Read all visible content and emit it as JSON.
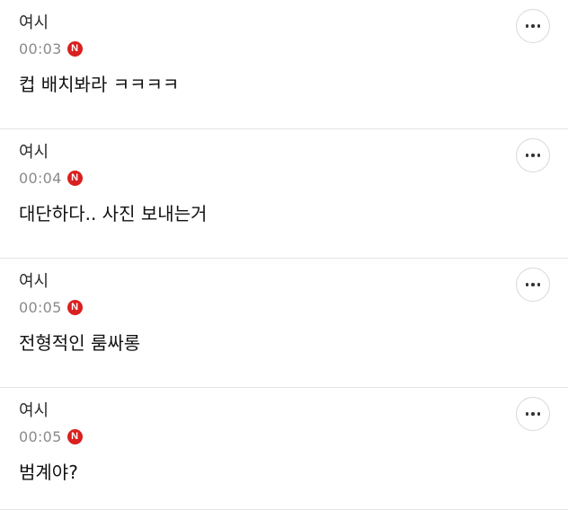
{
  "comments": [
    {
      "author": "여시",
      "time": "00:03",
      "badge": "N",
      "text": "컵 배치봐라 ㅋㅋㅋㅋ"
    },
    {
      "author": "여시",
      "time": "00:04",
      "badge": "N",
      "text": "대단하다.. 사진 보내는거"
    },
    {
      "author": "여시",
      "time": "00:05",
      "badge": "N",
      "text": "전형적인 룸싸롱"
    },
    {
      "author": "여시",
      "time": "00:05",
      "badge": "N",
      "text": "범계야?"
    }
  ],
  "icons": {
    "more": "more-options-icon",
    "new": "new-badge-icon"
  },
  "colors": {
    "badge": "#d9201f",
    "time": "#8a8a8a",
    "divider": "#e4e4e4"
  }
}
